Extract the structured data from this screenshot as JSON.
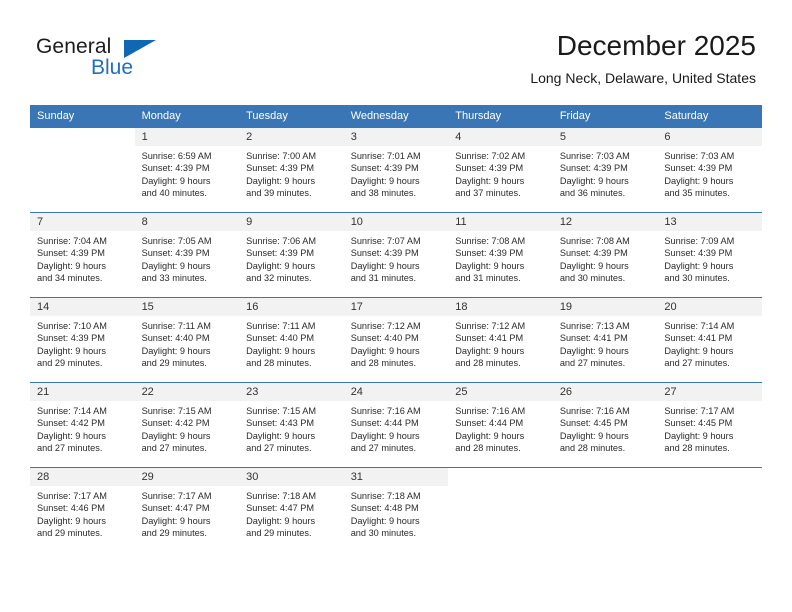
{
  "brand": {
    "name_part1": "General",
    "name_part2": "Blue",
    "accent_color": "#1068b4"
  },
  "header": {
    "month_title": "December 2025",
    "location": "Long Neck, Delaware, United States"
  },
  "theme": {
    "header_row_color": "#3a76b5",
    "daynum_band_color": "#f2f2f2",
    "text_color": "#2b2b2b"
  },
  "calendar": {
    "weekday_headers": [
      "Sunday",
      "Monday",
      "Tuesday",
      "Wednesday",
      "Thursday",
      "Friday",
      "Saturday"
    ],
    "weeks": [
      [
        {
          "day": "",
          "sunrise": "",
          "sunset": "",
          "daylight1": "",
          "daylight2": "",
          "blank": true
        },
        {
          "day": "1",
          "sunrise": "Sunrise: 6:59 AM",
          "sunset": "Sunset: 4:39 PM",
          "daylight1": "Daylight: 9 hours",
          "daylight2": "and 40 minutes."
        },
        {
          "day": "2",
          "sunrise": "Sunrise: 7:00 AM",
          "sunset": "Sunset: 4:39 PM",
          "daylight1": "Daylight: 9 hours",
          "daylight2": "and 39 minutes."
        },
        {
          "day": "3",
          "sunrise": "Sunrise: 7:01 AM",
          "sunset": "Sunset: 4:39 PM",
          "daylight1": "Daylight: 9 hours",
          "daylight2": "and 38 minutes."
        },
        {
          "day": "4",
          "sunrise": "Sunrise: 7:02 AM",
          "sunset": "Sunset: 4:39 PM",
          "daylight1": "Daylight: 9 hours",
          "daylight2": "and 37 minutes."
        },
        {
          "day": "5",
          "sunrise": "Sunrise: 7:03 AM",
          "sunset": "Sunset: 4:39 PM",
          "daylight1": "Daylight: 9 hours",
          "daylight2": "and 36 minutes."
        },
        {
          "day": "6",
          "sunrise": "Sunrise: 7:03 AM",
          "sunset": "Sunset: 4:39 PM",
          "daylight1": "Daylight: 9 hours",
          "daylight2": "and 35 minutes."
        }
      ],
      [
        {
          "day": "7",
          "sunrise": "Sunrise: 7:04 AM",
          "sunset": "Sunset: 4:39 PM",
          "daylight1": "Daylight: 9 hours",
          "daylight2": "and 34 minutes."
        },
        {
          "day": "8",
          "sunrise": "Sunrise: 7:05 AM",
          "sunset": "Sunset: 4:39 PM",
          "daylight1": "Daylight: 9 hours",
          "daylight2": "and 33 minutes."
        },
        {
          "day": "9",
          "sunrise": "Sunrise: 7:06 AM",
          "sunset": "Sunset: 4:39 PM",
          "daylight1": "Daylight: 9 hours",
          "daylight2": "and 32 minutes."
        },
        {
          "day": "10",
          "sunrise": "Sunrise: 7:07 AM",
          "sunset": "Sunset: 4:39 PM",
          "daylight1": "Daylight: 9 hours",
          "daylight2": "and 31 minutes."
        },
        {
          "day": "11",
          "sunrise": "Sunrise: 7:08 AM",
          "sunset": "Sunset: 4:39 PM",
          "daylight1": "Daylight: 9 hours",
          "daylight2": "and 31 minutes."
        },
        {
          "day": "12",
          "sunrise": "Sunrise: 7:08 AM",
          "sunset": "Sunset: 4:39 PM",
          "daylight1": "Daylight: 9 hours",
          "daylight2": "and 30 minutes."
        },
        {
          "day": "13",
          "sunrise": "Sunrise: 7:09 AM",
          "sunset": "Sunset: 4:39 PM",
          "daylight1": "Daylight: 9 hours",
          "daylight2": "and 30 minutes."
        }
      ],
      [
        {
          "day": "14",
          "sunrise": "Sunrise: 7:10 AM",
          "sunset": "Sunset: 4:39 PM",
          "daylight1": "Daylight: 9 hours",
          "daylight2": "and 29 minutes."
        },
        {
          "day": "15",
          "sunrise": "Sunrise: 7:11 AM",
          "sunset": "Sunset: 4:40 PM",
          "daylight1": "Daylight: 9 hours",
          "daylight2": "and 29 minutes."
        },
        {
          "day": "16",
          "sunrise": "Sunrise: 7:11 AM",
          "sunset": "Sunset: 4:40 PM",
          "daylight1": "Daylight: 9 hours",
          "daylight2": "and 28 minutes."
        },
        {
          "day": "17",
          "sunrise": "Sunrise: 7:12 AM",
          "sunset": "Sunset: 4:40 PM",
          "daylight1": "Daylight: 9 hours",
          "daylight2": "and 28 minutes."
        },
        {
          "day": "18",
          "sunrise": "Sunrise: 7:12 AM",
          "sunset": "Sunset: 4:41 PM",
          "daylight1": "Daylight: 9 hours",
          "daylight2": "and 28 minutes."
        },
        {
          "day": "19",
          "sunrise": "Sunrise: 7:13 AM",
          "sunset": "Sunset: 4:41 PM",
          "daylight1": "Daylight: 9 hours",
          "daylight2": "and 27 minutes."
        },
        {
          "day": "20",
          "sunrise": "Sunrise: 7:14 AM",
          "sunset": "Sunset: 4:41 PM",
          "daylight1": "Daylight: 9 hours",
          "daylight2": "and 27 minutes."
        }
      ],
      [
        {
          "day": "21",
          "sunrise": "Sunrise: 7:14 AM",
          "sunset": "Sunset: 4:42 PM",
          "daylight1": "Daylight: 9 hours",
          "daylight2": "and 27 minutes."
        },
        {
          "day": "22",
          "sunrise": "Sunrise: 7:15 AM",
          "sunset": "Sunset: 4:42 PM",
          "daylight1": "Daylight: 9 hours",
          "daylight2": "and 27 minutes."
        },
        {
          "day": "23",
          "sunrise": "Sunrise: 7:15 AM",
          "sunset": "Sunset: 4:43 PM",
          "daylight1": "Daylight: 9 hours",
          "daylight2": "and 27 minutes."
        },
        {
          "day": "24",
          "sunrise": "Sunrise: 7:16 AM",
          "sunset": "Sunset: 4:44 PM",
          "daylight1": "Daylight: 9 hours",
          "daylight2": "and 27 minutes."
        },
        {
          "day": "25",
          "sunrise": "Sunrise: 7:16 AM",
          "sunset": "Sunset: 4:44 PM",
          "daylight1": "Daylight: 9 hours",
          "daylight2": "and 28 minutes."
        },
        {
          "day": "26",
          "sunrise": "Sunrise: 7:16 AM",
          "sunset": "Sunset: 4:45 PM",
          "daylight1": "Daylight: 9 hours",
          "daylight2": "and 28 minutes."
        },
        {
          "day": "27",
          "sunrise": "Sunrise: 7:17 AM",
          "sunset": "Sunset: 4:45 PM",
          "daylight1": "Daylight: 9 hours",
          "daylight2": "and 28 minutes."
        }
      ],
      [
        {
          "day": "28",
          "sunrise": "Sunrise: 7:17 AM",
          "sunset": "Sunset: 4:46 PM",
          "daylight1": "Daylight: 9 hours",
          "daylight2": "and 29 minutes."
        },
        {
          "day": "29",
          "sunrise": "Sunrise: 7:17 AM",
          "sunset": "Sunset: 4:47 PM",
          "daylight1": "Daylight: 9 hours",
          "daylight2": "and 29 minutes."
        },
        {
          "day": "30",
          "sunrise": "Sunrise: 7:18 AM",
          "sunset": "Sunset: 4:47 PM",
          "daylight1": "Daylight: 9 hours",
          "daylight2": "and 29 minutes."
        },
        {
          "day": "31",
          "sunrise": "Sunrise: 7:18 AM",
          "sunset": "Sunset: 4:48 PM",
          "daylight1": "Daylight: 9 hours",
          "daylight2": "and 30 minutes."
        },
        {
          "day": "",
          "sunrise": "",
          "sunset": "",
          "daylight1": "",
          "daylight2": "",
          "blank": true
        },
        {
          "day": "",
          "sunrise": "",
          "sunset": "",
          "daylight1": "",
          "daylight2": "",
          "blank": true
        },
        {
          "day": "",
          "sunrise": "",
          "sunset": "",
          "daylight1": "",
          "daylight2": "",
          "blank": true
        }
      ]
    ]
  }
}
